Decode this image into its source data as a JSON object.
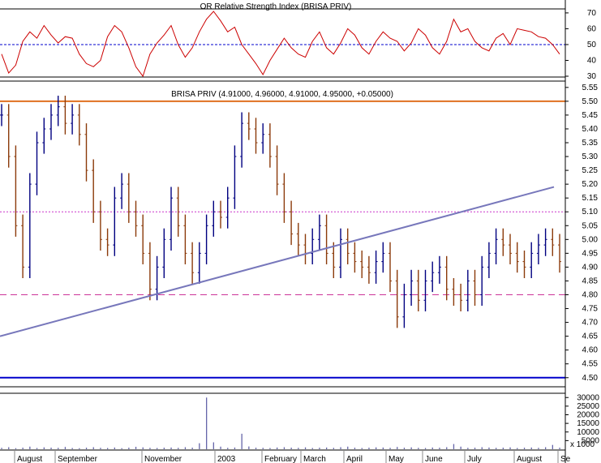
{
  "chart_data": [
    {
      "type": "line",
      "panel": "rsi",
      "title": "OR Relative Strength Index (BRISA PRIV)",
      "ylim": [
        30,
        72
      ],
      "yticks": [
        30,
        40,
        50,
        60,
        70
      ],
      "reference_lines": [
        {
          "value": 50,
          "style": "dashed",
          "color": "#0000cc"
        }
      ],
      "series": [
        {
          "name": "RSI",
          "color": "#cc0000",
          "values": [
            44,
            32,
            37,
            52,
            58,
            54,
            62,
            56,
            51,
            55,
            54,
            44,
            38,
            36,
            40,
            55,
            62,
            58,
            48,
            36,
            30,
            44,
            51,
            56,
            62,
            50,
            42,
            48,
            58,
            66,
            71,
            65,
            58,
            61,
            50,
            44,
            38,
            31,
            40,
            47,
            54,
            48,
            44,
            42,
            52,
            58,
            48,
            44,
            51,
            60,
            56,
            48,
            44,
            52,
            58,
            54,
            52,
            46,
            51,
            60,
            56,
            48,
            44,
            52,
            66,
            58,
            60,
            52,
            48,
            46,
            54,
            57,
            50,
            60,
            59,
            58,
            55,
            54,
            50,
            44
          ]
        }
      ]
    },
    {
      "type": "candlestick",
      "panel": "price",
      "title": "BRISA PRIV (4.91000, 4.96000, 4.91000, 4.95000, +0.05000)",
      "ylim": [
        4.47,
        5.57
      ],
      "yticks": [
        "5.55",
        "5.50",
        "5.45",
        "5.40",
        "5.35",
        "5.30",
        "5.25",
        "5.20",
        "5.15",
        "5.10",
        "5.05",
        "5.00",
        "4.95",
        "4.90",
        "4.85",
        "4.80",
        "4.75",
        "4.70",
        "4.65",
        "4.60",
        "4.55",
        "4.50"
      ],
      "last": {
        "open": 4.91,
        "high": 4.96,
        "low": 4.91,
        "close": 4.95,
        "change": 0.05
      },
      "horizontal_lines": [
        {
          "value": 5.5,
          "color": "#e07020",
          "style": "solid"
        },
        {
          "value": 5.1,
          "color": "#cc33cc",
          "style": "dotted"
        },
        {
          "value": 4.8,
          "color": "#cc3399",
          "style": "dashed"
        },
        {
          "value": 4.5,
          "color": "#0000cc",
          "style": "solid"
        }
      ],
      "trendline": {
        "from": 4.65,
        "to": 5.19,
        "color": "#7777bb"
      },
      "series": [
        {
          "name": "Close",
          "up_color": "#000080",
          "down_color": "#8b3a0a",
          "values": [
            5.45,
            5.3,
            5.05,
            4.9,
            5.2,
            5.35,
            5.4,
            5.45,
            5.48,
            5.42,
            5.45,
            5.38,
            5.25,
            5.1,
            5.0,
            4.98,
            5.15,
            5.2,
            5.1,
            5.05,
            4.95,
            4.82,
            4.9,
            5.0,
            5.15,
            5.05,
            4.95,
            4.88,
            4.95,
            5.05,
            5.1,
            5.08,
            5.15,
            5.3,
            5.42,
            5.4,
            5.35,
            5.38,
            5.3,
            5.2,
            5.1,
            5.02,
            4.98,
            4.95,
            5.0,
            5.05,
            4.95,
            4.9,
            5.0,
            4.95,
            4.92,
            4.9,
            4.88,
            4.92,
            4.95,
            4.85,
            4.72,
            4.8,
            4.85,
            4.78,
            4.85,
            4.88,
            4.9,
            4.82,
            4.8,
            4.78,
            4.85,
            4.8,
            4.9,
            4.95,
            5.0,
            4.98,
            4.95,
            4.92,
            4.9,
            4.95,
            4.98,
            5.0,
            4.98,
            4.92
          ]
        }
      ]
    },
    {
      "type": "bar",
      "panel": "volume",
      "ylim": [
        0,
        32000
      ],
      "yticks": [
        "30000",
        "25000",
        "20000",
        "15000",
        "10000",
        "5000"
      ],
      "unit_label": "x 1000",
      "series": [
        {
          "name": "Volume",
          "color": "#6666aa",
          "values": [
            800,
            1200,
            600,
            900,
            1500,
            700,
            1100,
            900,
            800,
            1300,
            700,
            600,
            900,
            1200,
            800,
            700,
            1000,
            600,
            900,
            1400,
            1100,
            800,
            700,
            900,
            1000,
            800,
            1200,
            900,
            3500,
            30000,
            4000,
            1500,
            800,
            1000,
            9000,
            1600,
            900,
            800,
            700,
            1000,
            1200,
            900,
            800,
            1100,
            700,
            900,
            1000,
            800,
            1200,
            1500,
            900,
            700,
            900,
            1100,
            1000,
            800,
            1300,
            900,
            1100,
            800,
            700,
            1000,
            900,
            1200,
            3000,
            1500,
            800,
            900,
            1200,
            1000,
            800,
            900,
            1100,
            700,
            900,
            1000,
            800,
            1200,
            2500,
            900
          ]
        }
      ]
    }
  ],
  "x_axis": {
    "labels": [
      "August",
      "September",
      "November",
      "2003",
      "February",
      "March",
      "April",
      "May",
      "June",
      "July",
      "August",
      "Se"
    ]
  }
}
